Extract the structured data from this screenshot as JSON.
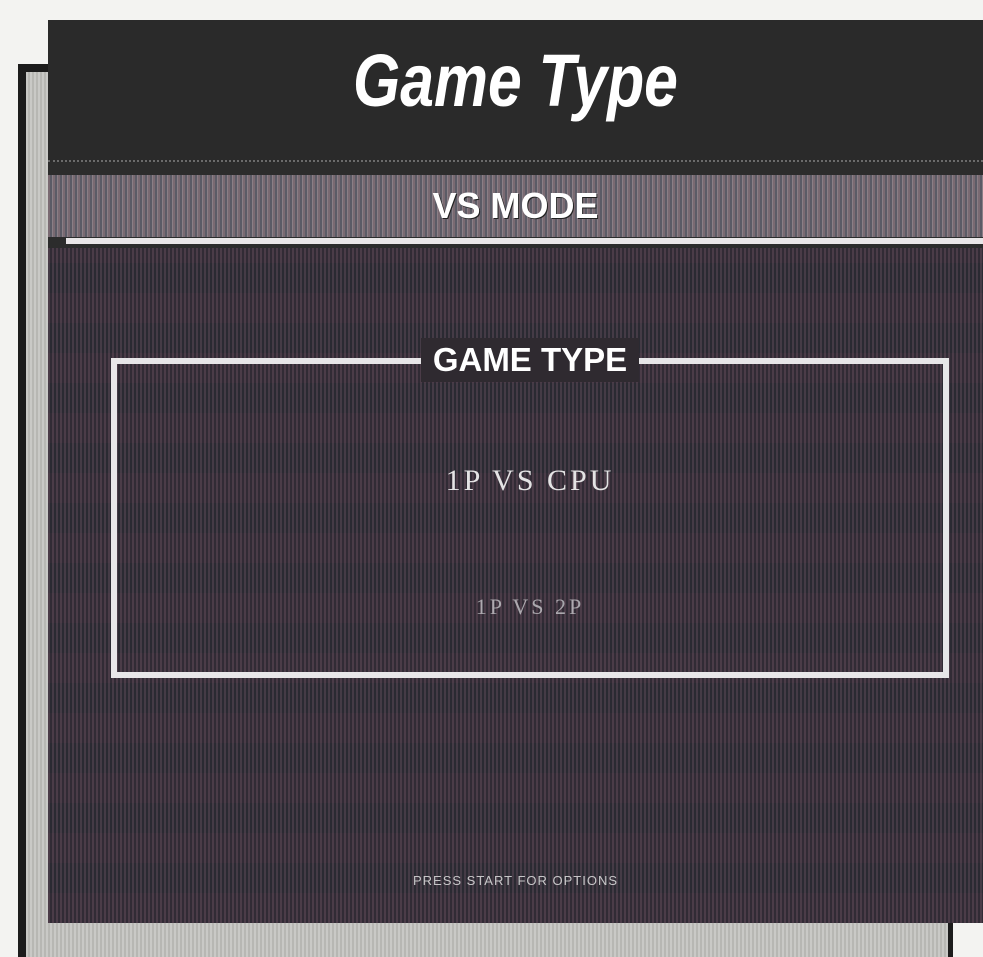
{
  "header": {
    "title": "Game Type"
  },
  "mode_band": {
    "label": "VS MODE"
  },
  "game_type_panel": {
    "legend": "GAME TYPE",
    "options": [
      {
        "label": "1P VS CPU",
        "selected": true
      },
      {
        "label": "1P VS 2P",
        "selected": false
      }
    ]
  },
  "footer": {
    "hint": "PRESS START FOR OPTIONS"
  },
  "colors": {
    "page_background": "#f3f3f1",
    "screen_background": "#2c2c2c",
    "frame_border": "#e7e6e8",
    "text": "#ffffff"
  }
}
